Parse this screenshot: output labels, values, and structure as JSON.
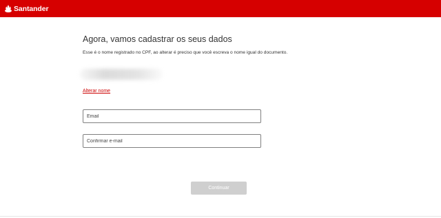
{
  "header": {
    "brand_name": "Santander",
    "brand_color": "#d60000",
    "logo_icon": "santander-flame-icon"
  },
  "main": {
    "title": "Agora, vamos cadastrar os seus dados",
    "subtitle": "Esse é o nome registrado no CPF, ao alterar é preciso que você escreva o nome igual do documento.",
    "alter_name_link": "Alterar nome",
    "email_placeholder": "Email",
    "confirm_email_placeholder": "Confirmar e-mail",
    "continue_label": "Continuar"
  },
  "colors": {
    "link": "#cc0000",
    "button_disabled": "#cfcfcf"
  }
}
